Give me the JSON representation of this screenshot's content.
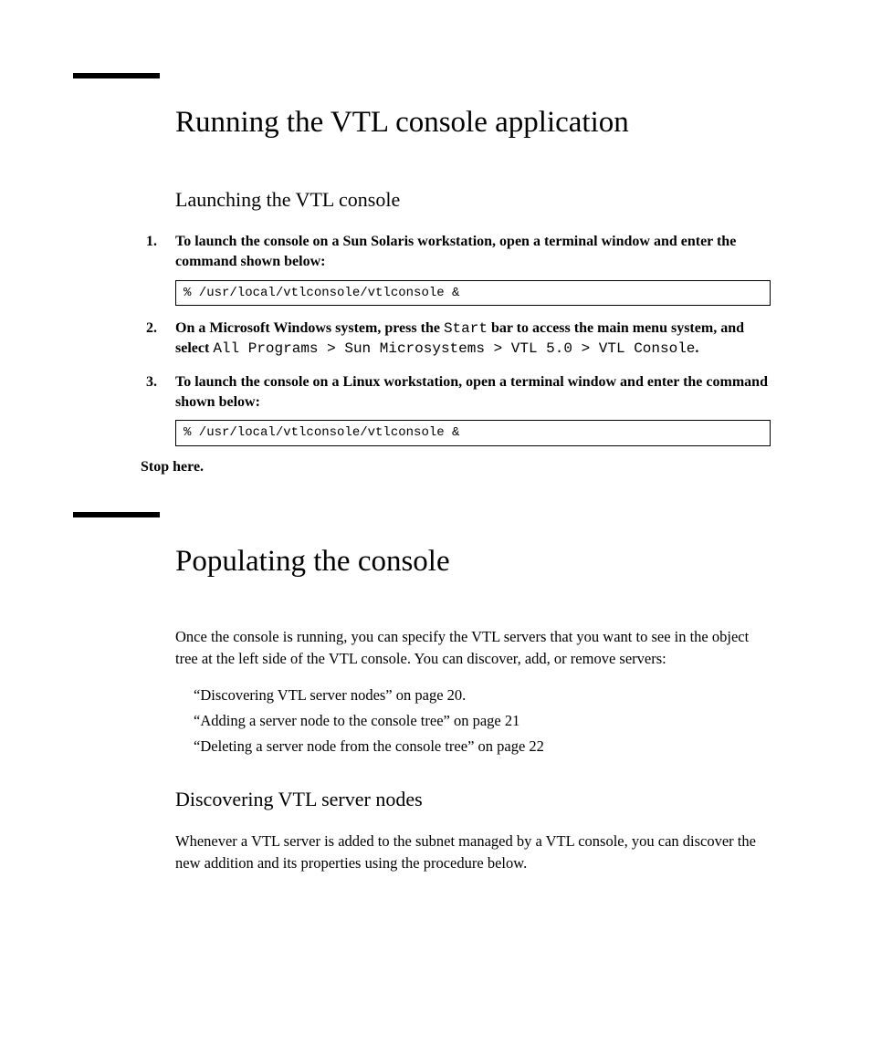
{
  "section1": {
    "title": "Running the VTL console application",
    "h2": "Launching the VTL console",
    "steps": {
      "s1": {
        "text": "To launch the console on a Sun Solaris workstation, open a terminal window and enter the command shown below:",
        "code": "% /usr/local/vtlconsole/vtlconsole &"
      },
      "s2": {
        "pre": "On a Microsoft Windows system, press the ",
        "start": "Start",
        "mid": " bar to access the main menu system, and select ",
        "path": "All Programs > Sun Microsystems > VTL 5.0 > VTL Console",
        "end": "."
      },
      "s3": {
        "text": "To launch the console on a Linux workstation, open a terminal window and enter the command shown below:",
        "code": "% /usr/local/vtlconsole/vtlconsole &"
      }
    },
    "stop": "Stop here."
  },
  "section2": {
    "title": "Populating the console",
    "intro": "Once the console is running, you can specify the VTL servers that you want to see in the object tree at the left side of the VTL console. You can discover, add, or remove servers:",
    "refs": {
      "r1": "“Discovering VTL server nodes” on page 20.",
      "r2": "“Adding a server node to the console tree” on page 21",
      "r3": "“Deleting a server node from the console tree” on page 22"
    },
    "h2": "Discovering VTL server nodes",
    "para": "Whenever a VTL server is added to the subnet managed by a VTL console, you can discover the new addition and its properties using the procedure below."
  }
}
